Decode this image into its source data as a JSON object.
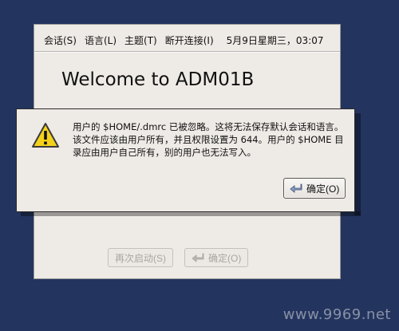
{
  "menubar": {
    "items": [
      {
        "label": "会话(S)"
      },
      {
        "label": "语言(L)"
      },
      {
        "label": "主题(T)"
      },
      {
        "label": "断开连接(I)"
      }
    ],
    "clock": "5月9日星期三，03:07"
  },
  "login": {
    "welcome": "Welcome to ADM01B",
    "restart_button": "再次启动(S)",
    "ok_button": "确定(O)"
  },
  "warning": {
    "message": "用户的 $HOME/.dmrc 已被忽略。这将无法保存默认会话和语言。该文件应该由用户所有，并且权限设置为 644。用户的 $HOME 目录应由用户自己所有，别的用户也无法写入。",
    "ok_button": "确定(O)"
  },
  "watermark": "www.9969.net",
  "colors": {
    "desktop": "#23345f",
    "window": "#eeeae6",
    "warning_yellow": "#f4d21c"
  }
}
